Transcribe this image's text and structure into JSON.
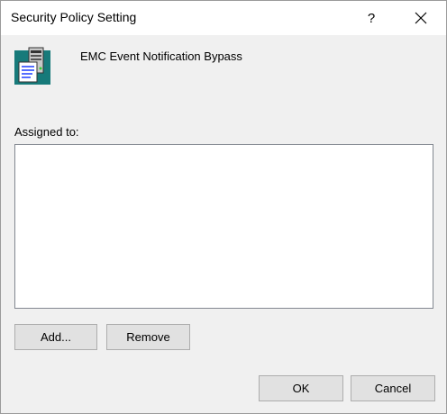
{
  "window": {
    "title": "Security Policy Setting",
    "help_label": "?"
  },
  "policy": {
    "name": "EMC Event Notification Bypass",
    "icon": "policy-computer-icon"
  },
  "assigned": {
    "label": "Assigned to:",
    "items": []
  },
  "buttons": {
    "add": "Add...",
    "remove": "Remove",
    "ok": "OK",
    "cancel": "Cancel"
  }
}
